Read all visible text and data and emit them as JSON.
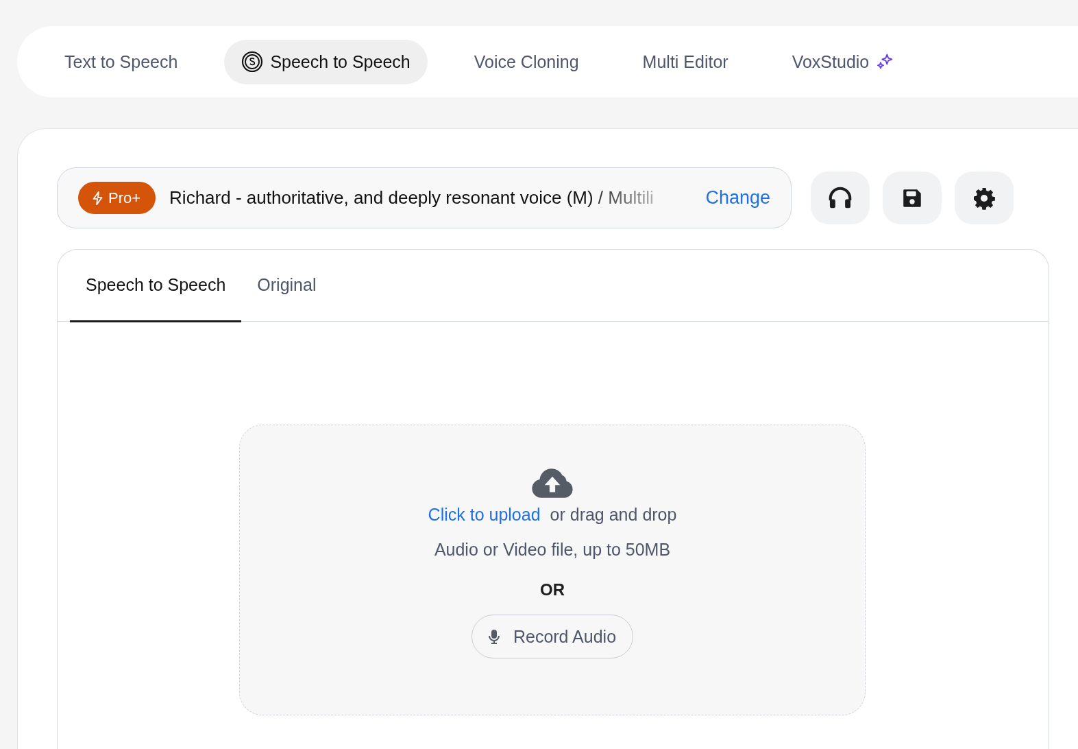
{
  "nav_tabs": [
    {
      "label": "Text to Speech",
      "selected": false,
      "kind": "plain"
    },
    {
      "label": "Speech to Speech",
      "selected": true,
      "kind": "coin"
    },
    {
      "label": "Voice Cloning",
      "selected": false,
      "kind": "plain"
    },
    {
      "label": "Multi Editor",
      "selected": false,
      "kind": "plain"
    },
    {
      "label": "VoxStudio",
      "selected": false,
      "kind": "sparkle"
    }
  ],
  "voice": {
    "badge": "Pro+",
    "name": "Richard - authoritative, and deeply resonant voice (M) / Multili",
    "action": "Change"
  },
  "tool_buttons": [
    {
      "kind": "headphones"
    },
    {
      "kind": "save"
    },
    {
      "kind": "settings"
    }
  ],
  "panel_tabs": [
    {
      "label": "Speech to Speech",
      "selected": true
    },
    {
      "label": "Original",
      "selected": false
    }
  ],
  "upload": {
    "link": "Click to upload",
    "text": "or drag and drop",
    "hint": "Audio or Video file, up to 50MB",
    "divider": "OR",
    "record": "Record Audio"
  }
}
